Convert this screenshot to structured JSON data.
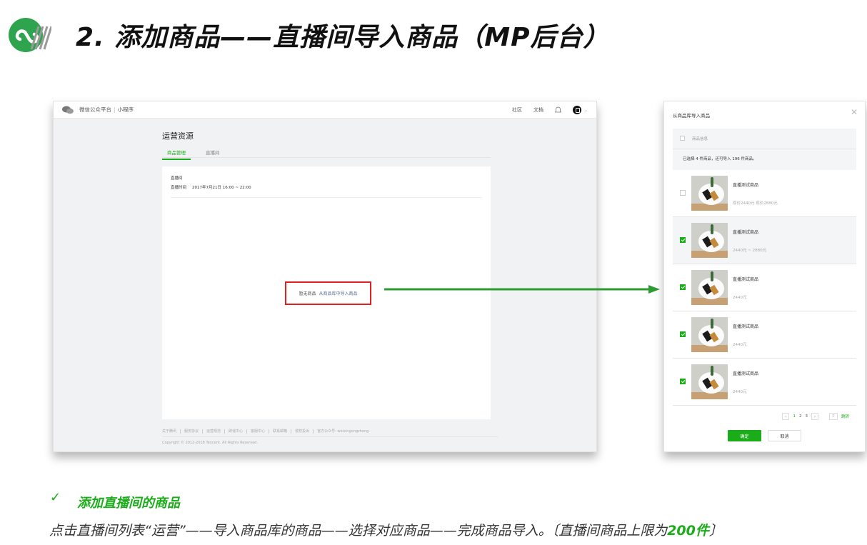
{
  "slide": {
    "title": "2. 添加商品——直播间导入商品（MP后台）",
    "colors": {
      "accent": "#1aad19",
      "highlight_box": "#e02020",
      "arrow": "#2e9b32"
    }
  },
  "mp_backend": {
    "brand": "微信公众平台",
    "product": "小程序",
    "nav": {
      "community": "社区",
      "docs": "文档"
    },
    "section_title": "运营资源",
    "tabs": [
      {
        "label": "商品管理",
        "active": true
      },
      {
        "label": "直播间",
        "active": false
      }
    ],
    "room": {
      "name": "直播间",
      "time_label": "直播时间",
      "time_value": "2017年7月21日 16:00 ~ 22:00"
    },
    "empty": {
      "text": "暂无商品",
      "link": "从商品库中导入商品"
    },
    "footer": {
      "links": [
        "关于腾讯",
        "服务协议",
        "运营规范",
        "辟谣中心",
        "客服中心",
        "联系邮箱",
        "侵权投诉",
        "官方公众号: weixingongzhong"
      ],
      "copyright": "Copyright © 2012-2018 Tencent. All Rights Reserved."
    }
  },
  "dialog": {
    "title": "从商品库导入商品",
    "header_label": "商品信息",
    "selection_text": "已选择 4 件商品，还可导入 196 件商品。",
    "items": [
      {
        "name": "直播测试商品",
        "price": "原价2440元    现价2880元",
        "checked": false,
        "highlighted": false
      },
      {
        "name": "直播测试商品",
        "price": "2440元 ~ 2880元",
        "checked": true,
        "highlighted": true
      },
      {
        "name": "直播测试商品",
        "price": "2440元",
        "checked": true,
        "highlighted": false
      },
      {
        "name": "直播测试商品",
        "price": "2440元",
        "checked": true,
        "highlighted": false
      },
      {
        "name": "直播测试商品",
        "price": "2440元",
        "checked": true,
        "highlighted": false
      }
    ],
    "pagination": {
      "pages": [
        "1",
        "2",
        "3"
      ],
      "current": "1",
      "input_placeholder": "0",
      "go_label": "跳转"
    },
    "confirm_label": "确定",
    "cancel_label": "取消"
  },
  "caption": {
    "heading": "添加直播间的商品",
    "body_text": "点击直播间列表“运营”——导入商品库的商品——选择对应商品——完成商品导入。〔直播间商品上限为",
    "limit": "200件",
    "body_end": "〕"
  }
}
